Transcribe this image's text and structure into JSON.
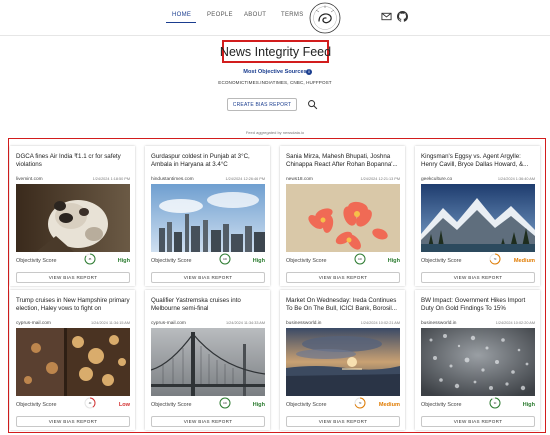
{
  "nav": {
    "items": [
      {
        "label": "HOME",
        "active": true
      },
      {
        "label": "PEOPLE",
        "active": false
      },
      {
        "label": "ABOUT",
        "active": false
      },
      {
        "label": "TERMS",
        "active": false
      }
    ],
    "mail_icon": "mail-icon",
    "github_icon": "github-icon"
  },
  "header": {
    "title": "News Integrity Feed",
    "most_objective_label": "Most Objective Sources",
    "sources": "ECONOMICTIMES.INDIATIMES, CNBC, HUFFPOST",
    "create_button": "CREATE BIAS REPORT",
    "powered_by": "Feed aggregated by newsdata.io"
  },
  "colors": {
    "accent": "#1a3d8f",
    "high": "#2e7d32",
    "medium": "#e07b00",
    "low": "#d32f2f",
    "highlight": "#d21d1d"
  },
  "cards": [
    {
      "title": "DGCA fines Air India ₹1.1 cr for safety violations",
      "source": "livemint.com",
      "time": "1/24/2024 1:18:50 PM",
      "score_label": "Objectivity Score",
      "score": 85,
      "bias": "High",
      "bias_level": "high",
      "button": "VIEW BIAS REPORT",
      "image": "dog"
    },
    {
      "title": "Gurdaspur coldest in Punjab at 3°C, Ambala in Haryana at 3.4°C",
      "source": "hindustantimes.com",
      "time": "1/24/2024 12:26:46 PM",
      "score_label": "Objectivity Score",
      "score": 100,
      "bias": "High",
      "bias_level": "high",
      "button": "VIEW BIAS REPORT",
      "image": "city"
    },
    {
      "title": "Sania Mirza, Mahesh Bhupati, Joshna Chinappa React After Rohan Bopanna'...",
      "source": "news18.com",
      "time": "1/24/2024 12:21:13 PM",
      "score_label": "Objectivity Score",
      "score": 100,
      "bias": "High",
      "bias_level": "high",
      "button": "VIEW BIAS REPORT",
      "image": "flowers"
    },
    {
      "title": "Kingsman's Eggsy vs. Agent Argylle: Henry Cavill, Bryce Dallas Howard, &...",
      "source": "geekculture.co",
      "time": "1/24/2024 1:36:40 AM",
      "score_label": "Objectivity Score",
      "score": 70,
      "bias": "Medium",
      "bias_level": "medium",
      "button": "VIEW BIAS REPORT",
      "image": "mountains"
    },
    {
      "title": "Trump cruises in New Hampshire primary election, Haley vows to fight on",
      "source": "cyprus-mail.com",
      "time": "1/24/2024 11:34:15 AM",
      "score_label": "Objectivity Score",
      "score": 40,
      "bias": "Low",
      "bias_level": "low",
      "button": "VIEW BIAS REPORT",
      "image": "bokeh"
    },
    {
      "title": "Qualifier Yastremska cruises into Melbourne semi-final",
      "source": "cyprus-mail.com",
      "time": "1/24/2024 11:34:33 AM",
      "score_label": "Objectivity Score",
      "score": 100,
      "bias": "High",
      "bias_level": "high",
      "button": "VIEW BIAS REPORT",
      "image": "bridge"
    },
    {
      "title": "Market On Wednesday: Ireda Continues To Be On The Bull, ICICI Bank, Borosil...",
      "source": "businessworld.in",
      "time": "1/24/2024 10:02:21 AM",
      "score_label": "Objectivity Score",
      "score": 70,
      "bias": "Medium",
      "bias_level": "medium",
      "button": "VIEW BIAS REPORT",
      "image": "sunset"
    },
    {
      "title": "BW Impact: Government Hikes Import Duty On Gold Findings To 15%",
      "source": "businessworld.in",
      "time": "1/24/2024 10:02:20 AM",
      "score_label": "Objectivity Score",
      "score": 90,
      "bias": "High",
      "bias_level": "high",
      "button": "VIEW BIAS REPORT",
      "image": "droplets"
    }
  ]
}
